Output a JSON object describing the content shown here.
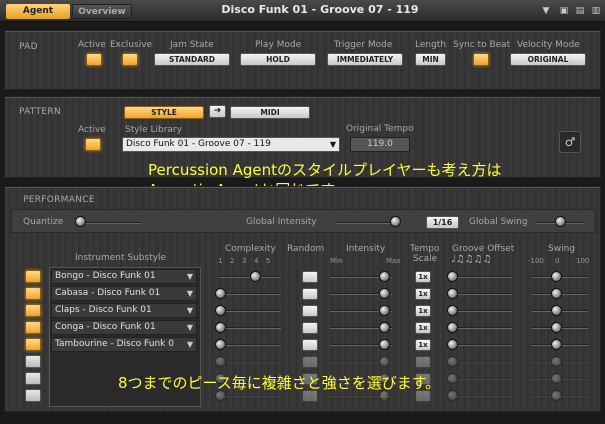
{
  "topbar": {
    "tab_agent": "Agent",
    "tab_overview": "Overview",
    "preset_name": "Disco Funk 01 - Groove 07 - 119"
  },
  "pad": {
    "title": "PAD",
    "active_label": "Active",
    "exclusive_label": "Exclusive",
    "jam_state_label": "Jam State",
    "jam_state_value": "STANDARD",
    "play_mode_label": "Play Mode",
    "play_mode_value": "HOLD",
    "trigger_mode_label": "Trigger Mode",
    "trigger_mode_value": "IMMEDIATELY",
    "length_label": "Length",
    "length_value": "MIN",
    "sync_label": "Sync to Beat",
    "velocity_label": "Velocity Mode",
    "velocity_value": "ORIGINAL"
  },
  "pattern": {
    "title": "PATTERN",
    "style_button": "STYLE",
    "midi_button": "MIDI",
    "active_label": "Active",
    "style_library_label": "Style Library",
    "style_library_value": "Disco Funk 01 - Groove 07 - 119",
    "original_tempo_label": "Original Tempo",
    "original_tempo_value": "119.0"
  },
  "overlay": {
    "line1": "Percussion Agentのスタイルプレイヤーも考え方は",
    "line2": "Acoustic Agentと同じです。",
    "line3": "8つまでのピース毎に複雑さと強さを選びます。"
  },
  "performance": {
    "title": "PERFORMANCE",
    "quantize_label": "Quantize",
    "global_intensity_label": "Global Intensity",
    "quantize_value": "1/16",
    "global_swing_label": "Global Swing",
    "instrument_substyle_label": "Instrument Substyle",
    "complexity_label": "Complexity",
    "complexity_ticks": [
      "1",
      "2",
      "3",
      "4",
      "5"
    ],
    "random_label": "Random",
    "intensity_label": "Intensity",
    "intensity_min": "Min",
    "intensity_max": "Max",
    "tempo_scale_label_1": "Tempo",
    "tempo_scale_label_2": "Scale",
    "groove_offset_label": "Groove Offset",
    "groove_notes": "♩♫♫♫♫",
    "swing_label": "Swing",
    "swing_ticks": [
      "-100",
      "0",
      "100"
    ],
    "instruments": [
      {
        "name": "Bongo - Disco Funk 01",
        "active": true,
        "tempo_scale": "1x"
      },
      {
        "name": "Cabasa - Disco Funk 01",
        "active": true,
        "tempo_scale": "1x"
      },
      {
        "name": "Claps - Disco Funk 01",
        "active": true,
        "tempo_scale": "1x"
      },
      {
        "name": "Conga - Disco Funk 01",
        "active": true,
        "tempo_scale": "1x"
      },
      {
        "name": "Tambourine - Disco Funk 0",
        "active": true,
        "tempo_scale": "1x"
      },
      {
        "name": "",
        "active": false,
        "tempo_scale": ""
      },
      {
        "name": "",
        "active": false,
        "tempo_scale": ""
      },
      {
        "name": "",
        "active": false,
        "tempo_scale": ""
      }
    ]
  }
}
